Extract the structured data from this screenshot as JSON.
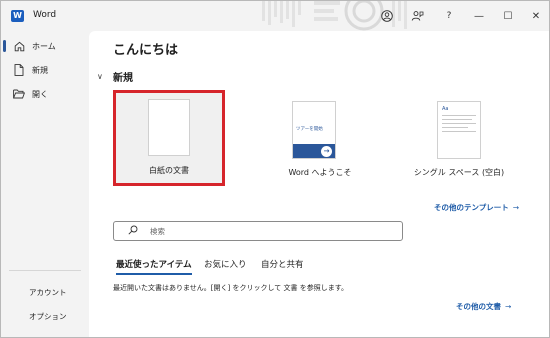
{
  "app": {
    "icon_letter": "W",
    "title": "Word"
  },
  "titlebar": {
    "help_label": "?",
    "minimize_glyph": "—",
    "maximize_glyph": "☐",
    "close_glyph": "✕"
  },
  "sidebar": {
    "items": [
      {
        "label": "ホーム",
        "icon": "home-icon",
        "active": true
      },
      {
        "label": "新規",
        "icon": "new-document-icon",
        "active": false
      },
      {
        "label": "開く",
        "icon": "folder-open-icon",
        "active": false
      }
    ],
    "bottom_items": [
      {
        "label": "アカウント"
      },
      {
        "label": "オプション"
      }
    ]
  },
  "main": {
    "greeting": "こんにちは",
    "new_section": {
      "toggle_glyph": "∨",
      "title": "新規"
    },
    "templates": [
      {
        "label": "白紙の文書",
        "selected": true
      },
      {
        "label": "Word へようこそ",
        "thumb_text": "ツアーを開始"
      },
      {
        "label": "シングル スペース (空白)",
        "thumb_text": "Aa"
      }
    ],
    "more_templates": {
      "label": "その他のテンプレート",
      "arrow": "→"
    },
    "search": {
      "placeholder": "検索"
    },
    "tabs": [
      {
        "label": "最近使ったアイテム",
        "active": true
      },
      {
        "label": "お気に入り"
      },
      {
        "label": "自分と共有"
      }
    ],
    "empty_message": "最近開いた文書はありません。[開く] をクリックして 文書 を参照します。",
    "more_documents": {
      "label": "その他の文書",
      "arrow": "→"
    }
  },
  "colors": {
    "accent": "#2b579a",
    "link": "#1f5ca8",
    "highlight_border": "#d6252b",
    "sidebar_bg": "#f3f3f3",
    "main_bg": "#ffffff"
  }
}
